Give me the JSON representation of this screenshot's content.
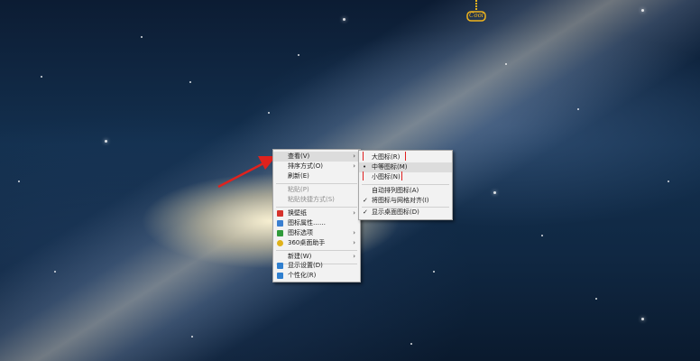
{
  "context_menu": {
    "items": [
      {
        "label": "查看(V)",
        "has_submenu": true,
        "active": true
      },
      {
        "label": "排序方式(O)",
        "has_submenu": true
      },
      {
        "label": "刷新(E)"
      },
      {
        "label": "粘贴(P)",
        "disabled": true
      },
      {
        "label": "粘贴快捷方式(S)",
        "disabled": true
      },
      {
        "label": "换壁纸",
        "has_submenu": true,
        "icon": "wallpaper-icon",
        "icon_color": "#d6322b"
      },
      {
        "label": "图标属性……",
        "icon": "icon-properties-icon",
        "icon_color": "#3a7fd0"
      },
      {
        "label": "图标选项",
        "has_submenu": true,
        "icon": "icon-options-icon",
        "icon_color": "#2f9a3a"
      },
      {
        "label": "360桌面助手",
        "has_submenu": true,
        "icon": "360-assistant-icon",
        "icon_color": "#e0b21a"
      },
      {
        "label": "新建(W)",
        "has_submenu": true
      },
      {
        "label": "显示设置(D)",
        "icon": "display-settings-icon",
        "icon_color": "#2f7fcf"
      },
      {
        "label": "个性化(R)",
        "icon": "personalize-icon",
        "icon_color": "#2f7fcf"
      }
    ]
  },
  "view_submenu": {
    "items": [
      {
        "label": "大图标(R)"
      },
      {
        "label": "中等图标(M)",
        "mark": "•"
      },
      {
        "label": "小图标(N)"
      },
      {
        "label": "自动排列图标(A)"
      },
      {
        "label": "将图标与网格对齐(I)",
        "mark": "✓"
      },
      {
        "label": "显示桌面图标(D)",
        "mark": "✓"
      }
    ]
  },
  "pendant": {
    "text": "Cool"
  },
  "colors": {
    "arrow": "#e0221d",
    "menu_bg": "#f2f2f2",
    "highlight": "#dcdcdc"
  }
}
